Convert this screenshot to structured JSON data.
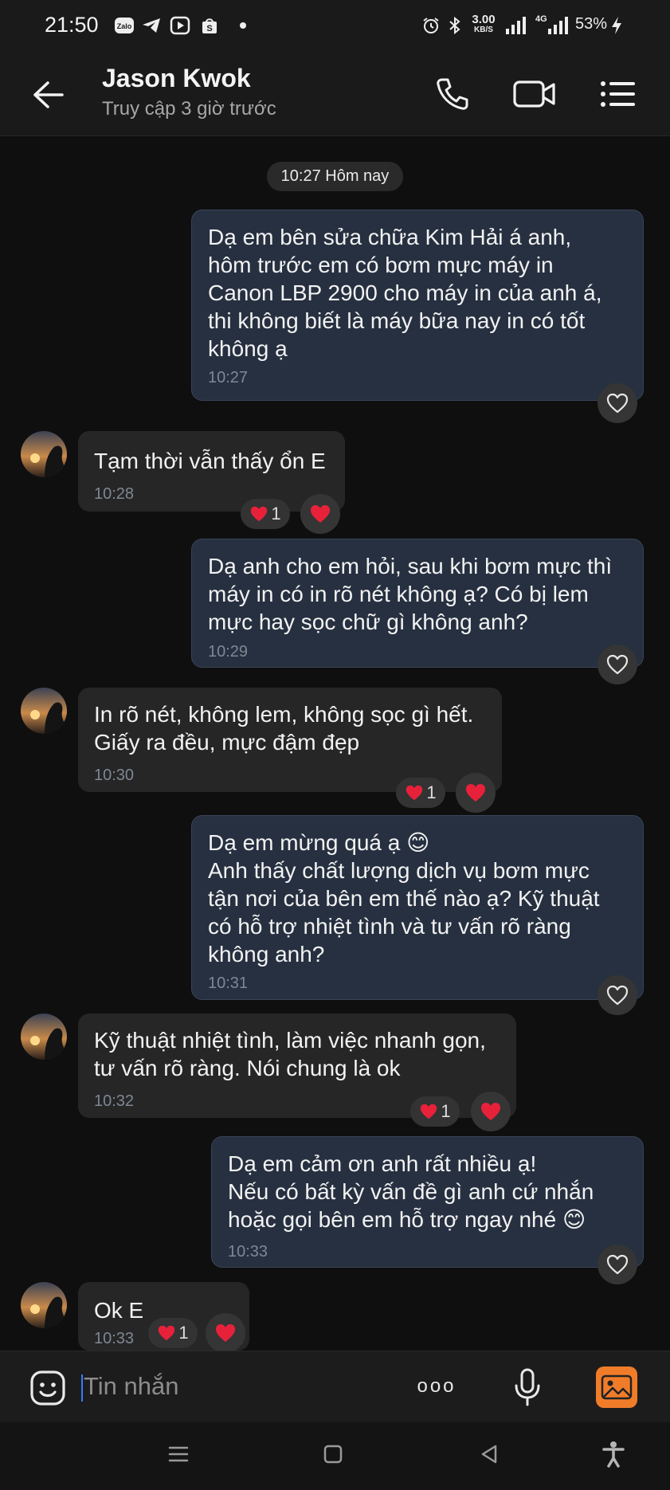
{
  "status_bar": {
    "time": "21:50",
    "net_speed_value": "3.00",
    "net_speed_unit": "KB/S",
    "network_label": "4G",
    "battery": "53%"
  },
  "header": {
    "contact_name": "Jason Kwok",
    "contact_status": "Truy cập 3 giờ trước"
  },
  "chat": {
    "date_separator": "10:27 Hôm nay",
    "messages": [
      {
        "dir": "out",
        "text": "Dạ em bên sửa chữa Kim Hải á anh,\nhôm trước em có bơm mực máy in\nCanon LBP 2900 cho máy in của anh á,\nthi không biết là máy bữa nay in có tốt\nkhông ạ",
        "time": "10:27"
      },
      {
        "dir": "in",
        "text": "Tạm thời vẫn thấy ổn E",
        "time": "10:28",
        "reaction_count": "1"
      },
      {
        "dir": "out",
        "text": "Dạ anh cho em hỏi, sau khi bơm mực thì\nmáy in có in rõ nét không ạ? Có bị lem\nmực hay sọc chữ gì không anh?",
        "time": "10:29"
      },
      {
        "dir": "in",
        "text": "In rõ nét, không lem, không sọc gì hết.\nGiấy ra đều, mực đậm đẹp",
        "time": "10:30",
        "reaction_count": "1"
      },
      {
        "dir": "out",
        "text": "Dạ em mừng quá ạ 😊\nAnh thấy chất lượng dịch vụ bơm mực\ntận nơi của bên em thế nào ạ? Kỹ thuật\ncó hỗ trợ nhiệt tình và tư vấn rõ ràng\nkhông anh?",
        "time": "10:31"
      },
      {
        "dir": "in",
        "text": "Kỹ thuật nhiệt tình, làm việc nhanh gọn,\ntư vấn rõ ràng. Nói chung là ok",
        "time": "10:32",
        "reaction_count": "1"
      },
      {
        "dir": "out",
        "text": "Dạ em cảm ơn anh rất nhiều ạ!\nNếu có bất kỳ vấn đề gì anh cứ nhắn\nhoặc gọi bên em hỗ trợ ngay nhé 😊",
        "time": "10:33"
      },
      {
        "dir": "in",
        "text": "Ok E",
        "time": "10:33",
        "reaction_count": "1"
      }
    ]
  },
  "input": {
    "placeholder": "Tin nhắn",
    "more_label": "ooo"
  },
  "icons": {
    "back": "arrow-left-icon",
    "call": "phone-icon",
    "video": "video-camera-icon",
    "menu": "list-menu-icon",
    "sticker": "sticker-smile-icon",
    "mic": "microphone-icon",
    "image": "image-gallery-icon"
  },
  "colors": {
    "background": "#0f0f10",
    "outgoing_bubble": "#263040",
    "incoming_bubble": "#262626",
    "heart": "#e8213a",
    "gallery_accent": "#f07c2a"
  }
}
